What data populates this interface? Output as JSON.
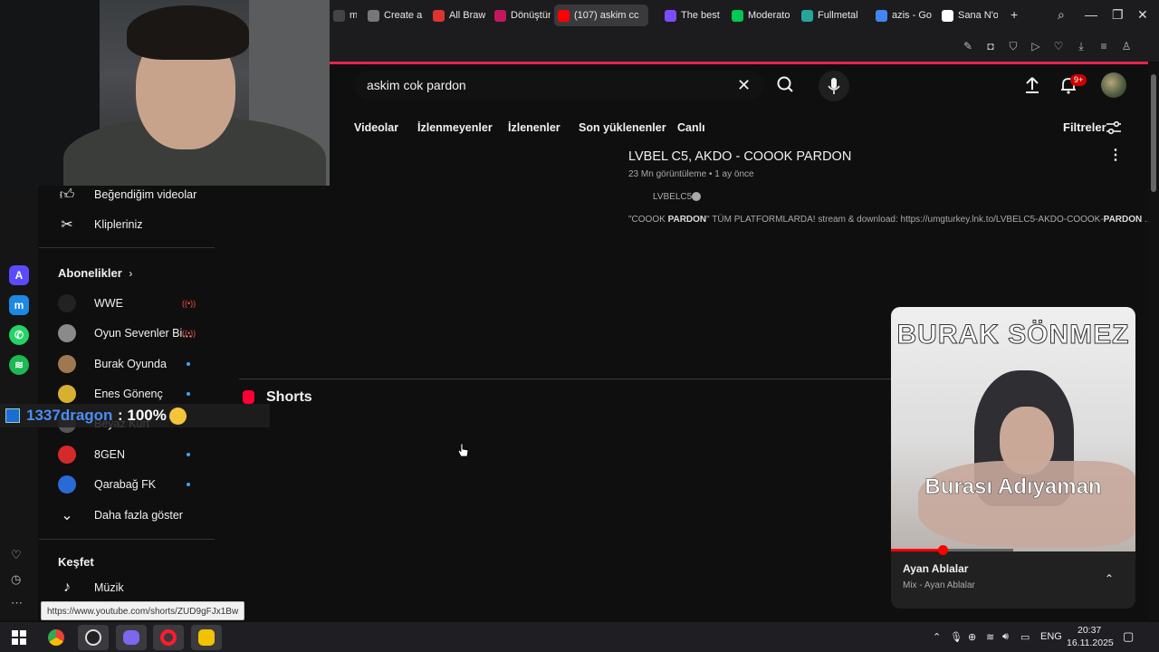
{
  "browser": {
    "tabs": [
      {
        "label": "metal",
        "color": "#444"
      },
      {
        "label": "Create a A",
        "color": "#777"
      },
      {
        "label": "All Brawler",
        "color": "#d33"
      },
      {
        "label": "Dönüştürü",
        "color": "#c2185b"
      },
      {
        "label": "(107) askim cc",
        "color": "#ff0000",
        "active": true
      },
      {
        "label": "The best C",
        "color": "#7c4dff"
      },
      {
        "label": "Moderato",
        "color": "#00c853"
      },
      {
        "label": "Fullmetal",
        "color": "#26a69a"
      },
      {
        "label": "azis - Goo",
        "color": "#4285f4"
      },
      {
        "label": "Sana N'ol",
        "color": "#ffffff"
      }
    ],
    "new_tab": "+"
  },
  "youtube": {
    "search": {
      "value": "askim cok pardon"
    },
    "notif_badge": "9+",
    "chips": [
      "Videolar",
      "İzlenmeyenler",
      "İzlenenler",
      "Son yüklenenler",
      "Canlı"
    ],
    "filters_label": "Filtreler",
    "result": {
      "title": "LVBEL C5, AKDO - COOOK PARDON",
      "meta": "23 Mn görüntüleme • 1 ay önce",
      "channel": "LVBELC5",
      "desc_prefix": "\"COOOK ",
      "desc_bold1": "PARDON",
      "desc_mid": "\" TÜM PLATFORMLARDA! stream & download: https://umgturkey.lnk.to/LVBELC5-AKDO-COOOK-",
      "desc_bold2": "PARDON",
      "desc_suffix": " ..."
    },
    "shorts_title": "Shorts"
  },
  "sidebar": {
    "top_items": [
      {
        "label": "Beğendiğim videolar",
        "icon": "thumbs-up-icon"
      },
      {
        "label": "Klipleriniz",
        "icon": "scissors-icon"
      }
    ],
    "subscriptions_title": "Abonelikler",
    "subscriptions": [
      {
        "label": "WWE",
        "status": "live",
        "avatar": "#222"
      },
      {
        "label": "Oyun Sevenler Bi...",
        "status": "live",
        "avatar": "#8a8a8a"
      },
      {
        "label": "Burak Oyunda",
        "status": "new",
        "avatar": "#a07850"
      },
      {
        "label": "Enes Gönenç",
        "status": "new",
        "avatar": "#d8b030"
      },
      {
        "label": "Beyaz Kurt",
        "status": "none",
        "avatar": "#555"
      },
      {
        "label": "8GEN",
        "status": "new",
        "avatar": "#d42a2a"
      },
      {
        "label": "Qarabağ FK",
        "status": "new",
        "avatar": "#2a6ad4"
      }
    ],
    "show_more": "Daha fazla göster",
    "explore_title": "Keşfet",
    "explore_items": [
      {
        "label": "Müzik",
        "icon": "music-note-icon"
      }
    ]
  },
  "overlay": {
    "name": "1337dragon",
    "text": ": 100%"
  },
  "miniplayer": {
    "top_caption": "BURAK SÖNMEZ",
    "mid_caption": "Burası Adıyaman",
    "title": "Ayan Ablalar",
    "subtitle": "Mix - Ayan Ablalar",
    "progress": 0.21
  },
  "status_url": "https://www.youtube.com/shorts/ZUD9gFJx1Bw",
  "taskbar": {
    "lang": "ENG",
    "time": "20:37",
    "date": "16.11.2025"
  },
  "colors": {
    "accent": "#ff0000",
    "opera_red": "#e2264d",
    "live": "#ff4e45",
    "new_dot": "#3ea6ff"
  }
}
